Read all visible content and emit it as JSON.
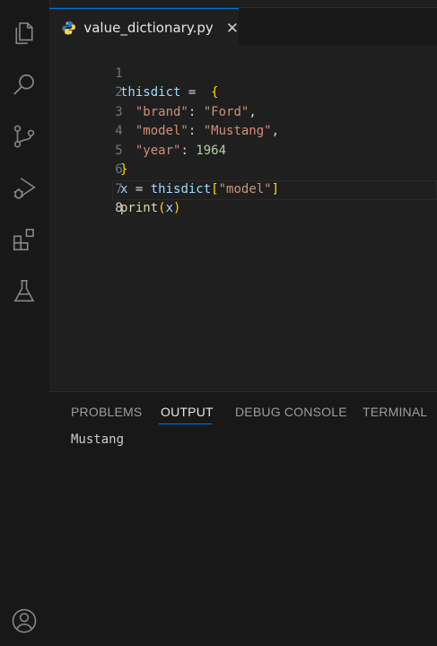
{
  "activity_bar": {
    "icons": [
      "files-icon",
      "search-icon",
      "source-control-icon",
      "run-debug-icon",
      "extensions-icon",
      "testing-icon",
      "account-icon"
    ]
  },
  "tab": {
    "filename": "value_dictionary.py",
    "close": "✕"
  },
  "editor": {
    "line_numbers": [
      "1",
      "2",
      "3",
      "4",
      "5",
      "6",
      "7",
      "8"
    ],
    "active_line": "8",
    "code": {
      "l1_var": "thisdict",
      "l1_op": " = ",
      "l1_brace": "{",
      "l2_key": "\"brand\"",
      "l2_sep": ": ",
      "l2_val": "\"Ford\"",
      "l2_comma": ",",
      "l3_key": "\"model\"",
      "l3_sep": ": ",
      "l3_val": "\"Mustang\"",
      "l3_comma": ",",
      "l4_key": "\"year\"",
      "l4_sep": ": ",
      "l4_val": "1964",
      "l5_brace": "}",
      "l6_var": "x",
      "l6_op": " = ",
      "l6_ref": "thisdict",
      "l6_open": "[",
      "l6_key": "\"model\"",
      "l6_close": "]",
      "l7_fn": "print",
      "l7_open": "(",
      "l7_arg": "x",
      "l7_close": ")"
    }
  },
  "panel": {
    "tabs": [
      "PROBLEMS",
      "OUTPUT",
      "DEBUG CONSOLE",
      "TERMINAL"
    ],
    "active_tab": "OUTPUT",
    "output": "Mustang"
  },
  "colors": {
    "accent": "#0078d4",
    "background": "#1e1e1e",
    "variable": "#9cdcfe",
    "string": "#ce9178",
    "number": "#b5cea8",
    "function": "#dcdcaa"
  }
}
